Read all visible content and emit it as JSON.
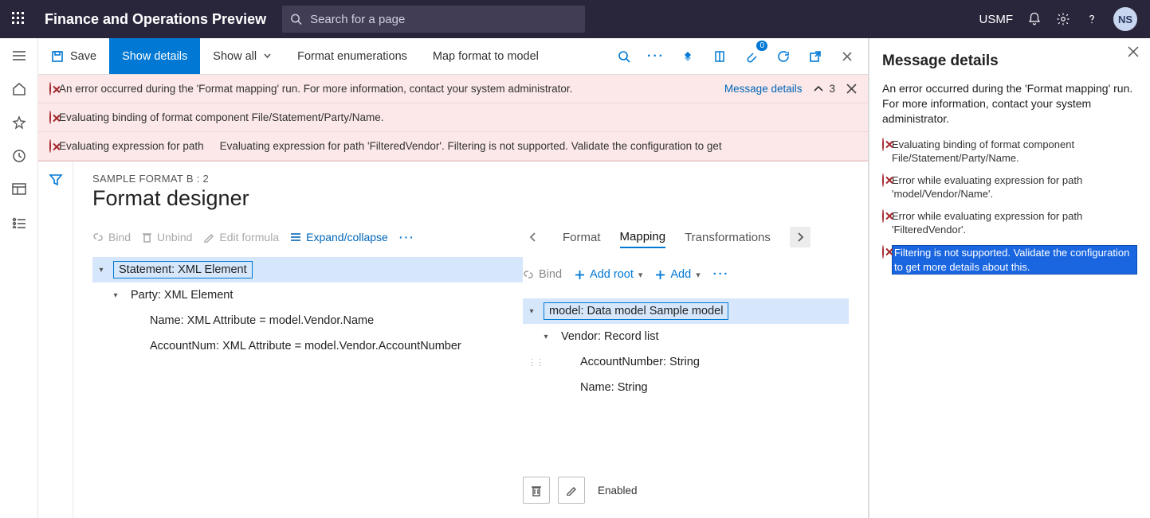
{
  "header": {
    "app_title": "Finance and Operations Preview",
    "search_placeholder": "Search for a page",
    "company": "USMF",
    "user_initials": "NS"
  },
  "cmdbar": {
    "save": "Save",
    "show_details": "Show details",
    "show_all": "Show all",
    "format_enum": "Format enumerations",
    "map_format": "Map format to model"
  },
  "banners": [
    {
      "text": "An error occurred during the 'Format mapping' run. For more information, contact your system administrator.",
      "link": "Message details",
      "count": "3"
    },
    {
      "text": "Evaluating binding of format component File/Statement/Party/Name."
    },
    {
      "text": "Evaluating expression for path",
      "text2": "Evaluating expression for path 'FilteredVendor'. Filtering is not supported. Validate the configuration to get"
    }
  ],
  "designer": {
    "breadcrumb": "SAMPLE FORMAT B : 2",
    "title": "Format designer",
    "left_toolbar": {
      "bind": "Bind",
      "unbind": "Unbind",
      "edit_formula": "Edit formula",
      "expand": "Expand/collapse"
    },
    "left_tree": [
      {
        "level": 0,
        "text": "Statement: XML Element",
        "selected": true,
        "caret": true
      },
      {
        "level": 1,
        "text": "Party: XML Element",
        "caret": true
      },
      {
        "level": 2,
        "text": "Name: XML Attribute = model.Vendor.Name"
      },
      {
        "level": 2,
        "text": "AccountNum: XML Attribute = model.Vendor.AccountNumber"
      }
    ],
    "tabs": {
      "format": "Format",
      "mapping": "Mapping",
      "transformations": "Transformations"
    },
    "right_toolbar": {
      "bind": "Bind",
      "add_root": "Add root",
      "add": "Add"
    },
    "right_tree": [
      {
        "level": 0,
        "text": "model: Data model Sample model",
        "selected": true,
        "caret": true
      },
      {
        "level": 1,
        "text": "Vendor: Record list",
        "caret": true
      },
      {
        "level": 2,
        "text": "AccountNumber: String"
      },
      {
        "level": 2,
        "text": "Name: String"
      }
    ],
    "enabled_label": "Enabled"
  },
  "msg_panel": {
    "title": "Message details",
    "desc": "An error occurred during the 'Format mapping' run. For more information, contact your system administrator.",
    "items": [
      {
        "text": "Evaluating binding of format component File/Statement/Party/Name."
      },
      {
        "text": "Error while evaluating expression for path 'model/Vendor/Name'."
      },
      {
        "text": "Error while evaluating expression for path 'FilteredVendor'."
      },
      {
        "text": "Filtering is not supported. Validate the configuration to get more details about this.",
        "hl": true
      }
    ]
  }
}
